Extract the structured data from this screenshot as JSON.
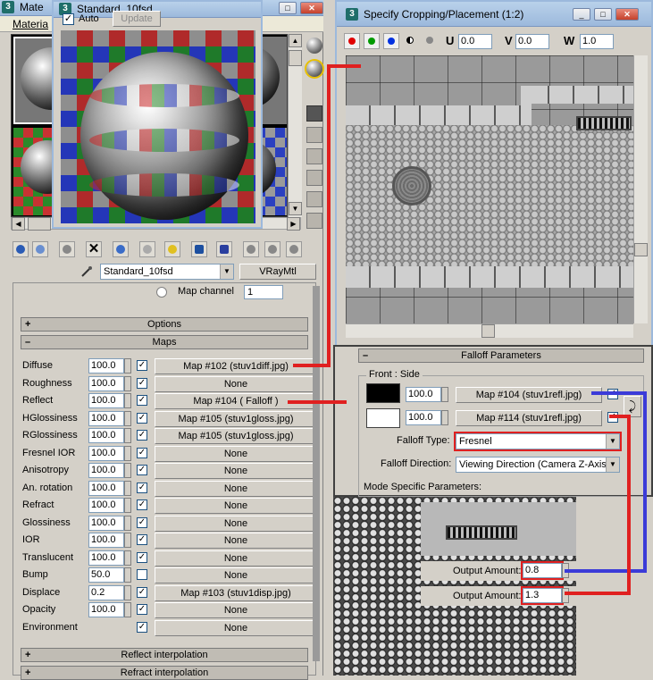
{
  "material_editor": {
    "title": "Mate",
    "menu_label": "Materia",
    "material_name": "Standard_10fsd",
    "material_type": "VRayMtl",
    "map_channel_label": "Map channel",
    "map_channel_value": "1",
    "rollouts": {
      "options": "Options",
      "maps": "Maps",
      "reflect_interp": "Reflect interpolation",
      "refract_interp": "Refract interpolation"
    },
    "maps": [
      {
        "label": "Diffuse",
        "amount": "100.0",
        "checked": true,
        "map": "Map #102 (stuv1diff.jpg)"
      },
      {
        "label": "Roughness",
        "amount": "100.0",
        "checked": true,
        "map": "None"
      },
      {
        "label": "Reflect",
        "amount": "100.0",
        "checked": true,
        "map": "Map #104  ( Falloff )"
      },
      {
        "label": "HGlossiness",
        "amount": "100.0",
        "checked": true,
        "map": "Map #105 (stuv1gloss.jpg)"
      },
      {
        "label": "RGlossiness",
        "amount": "100.0",
        "checked": true,
        "map": "Map #105 (stuv1gloss.jpg)"
      },
      {
        "label": "Fresnel IOR",
        "amount": "100.0",
        "checked": true,
        "map": "None"
      },
      {
        "label": "Anisotropy",
        "amount": "100.0",
        "checked": true,
        "map": "None"
      },
      {
        "label": "An. rotation",
        "amount": "100.0",
        "checked": true,
        "map": "None"
      },
      {
        "label": "Refract",
        "amount": "100.0",
        "checked": true,
        "map": "None"
      },
      {
        "label": "Glossiness",
        "amount": "100.0",
        "checked": true,
        "map": "None"
      },
      {
        "label": "IOR",
        "amount": "100.0",
        "checked": true,
        "map": "None"
      },
      {
        "label": "Translucent",
        "amount": "100.0",
        "checked": true,
        "map": "None"
      },
      {
        "label": "Bump",
        "amount": "50.0",
        "checked": false,
        "map": "None"
      },
      {
        "label": "Displace",
        "amount": "0.2",
        "checked": true,
        "map": "Map #103 (stuv1disp.jpg)"
      },
      {
        "label": "Opacity",
        "amount": "100.0",
        "checked": true,
        "map": "None"
      },
      {
        "label": "Environment",
        "amount": "",
        "checked": true,
        "map": "None"
      }
    ]
  },
  "preview": {
    "title": "Standard_10fsd",
    "auto_label": "Auto",
    "update_label": "Update",
    "auto_checked": true
  },
  "crop": {
    "title": "Specify Cropping/Placement (1:2)",
    "u_label": "U",
    "u_value": "0.0",
    "v_label": "V",
    "v_value": "0.0",
    "w_label": "W",
    "w_value": "1.0"
  },
  "falloff": {
    "title": "Falloff Parameters",
    "front_side_label": "Front : Side",
    "front_amount": "100.0",
    "front_map": "Map #104 (stuv1refl.jpg)",
    "side_amount": "100.0",
    "side_map": "Map #114 (stuv1refl.jpg)",
    "falloff_type_label": "Falloff Type:",
    "falloff_type_value": "Fresnel",
    "falloff_direction_label": "Falloff Direction:",
    "falloff_direction_value": "Viewing Direction (Camera Z-Axis)",
    "mode_specific_label": "Mode Specific Parameters:",
    "front_color": "#000000",
    "side_color": "#ffffff"
  },
  "outputs": [
    {
      "label": "Output Amount:",
      "value": "0.8"
    },
    {
      "label": "Output Amount:",
      "value": "1.3"
    }
  ],
  "colors": {
    "annotation_red": "#e02020",
    "annotation_blue": "#3b3bd8"
  }
}
